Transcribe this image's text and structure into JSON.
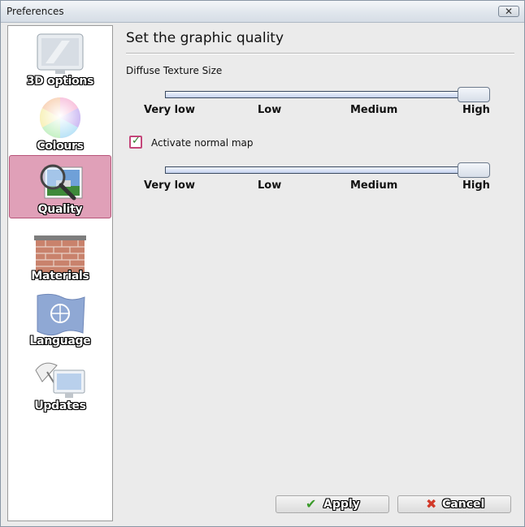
{
  "window": {
    "title": "Preferences",
    "close_symbol": "✕"
  },
  "sidebar": {
    "items": [
      {
        "label": "3D options",
        "icon": "monitor-icon",
        "selected": false
      },
      {
        "label": "Colours",
        "icon": "color-wheel-icon",
        "selected": false
      },
      {
        "label": "Quality",
        "icon": "magnifier-picture-icon",
        "selected": true
      },
      {
        "label": "Materials",
        "icon": "brick-wall-icon",
        "selected": false
      },
      {
        "label": "Language",
        "icon": "un-flag-icon",
        "selected": false
      },
      {
        "label": "Updates",
        "icon": "satellite-dish-icon",
        "selected": false
      }
    ]
  },
  "main": {
    "heading": "Set the graphic quality",
    "diffuse_label": "Diffuse Texture Size",
    "diffuse_slider": {
      "value": "High",
      "ticks": [
        "Very low",
        "Low",
        "Medium",
        "High"
      ]
    },
    "normal_map_checkbox": {
      "label": "Activate normal map",
      "checked": true
    },
    "normal_map_slider": {
      "value": "High",
      "ticks": [
        "Very low",
        "Low",
        "Medium",
        "High"
      ]
    }
  },
  "buttons": {
    "apply": {
      "label": "Apply",
      "icon": "check-icon"
    },
    "cancel": {
      "label": "Cancel",
      "icon": "x-icon"
    }
  },
  "colors": {
    "selection": "#e0a0b8",
    "selection_border": "#b8557a",
    "apply_icon": "#3a9a2a",
    "cancel_icon": "#d23a2a"
  }
}
